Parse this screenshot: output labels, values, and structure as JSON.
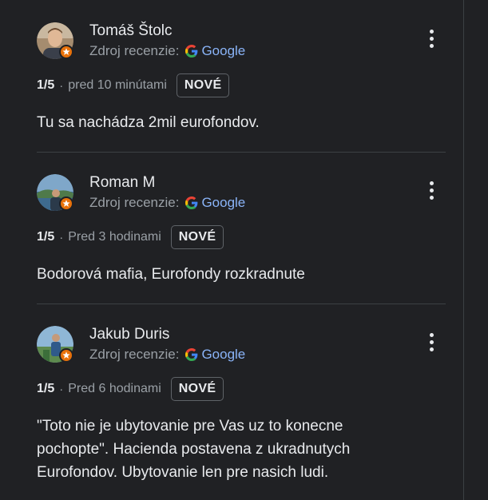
{
  "reviews": [
    {
      "name": "Tomáš Štolc",
      "source_label": "Zdroj recenzie:",
      "source_name": "Google",
      "rating": "1/5",
      "separator": "·",
      "time": "pred 10 minútami",
      "badge": "NOVÉ",
      "text": "Tu sa nachádza 2mil eurofondov."
    },
    {
      "name": "Roman M",
      "source_label": "Zdroj recenzie:",
      "source_name": "Google",
      "rating": "1/5",
      "separator": "·",
      "time": "Pred 3 hodinami",
      "badge": "NOVÉ",
      "text": "Bodorová mafia, Eurofondy rozkradnute"
    },
    {
      "name": "Jakub Duris",
      "source_label": "Zdroj recenzie:",
      "source_name": "Google",
      "rating": "1/5",
      "separator": "·",
      "time": "Pred 6 hodinami",
      "badge": "NOVÉ",
      "text": "\"Toto nie je ubytovanie pre Vas uz to konecne pochopte\". Hacienda postavena z ukradnutych Eurofondov. Ubytovanie len pre nasich ludi."
    }
  ],
  "icons": {
    "more": "more-vert-icon",
    "google": "google-g-icon",
    "local_guide": "local-guide-star-icon"
  },
  "colors": {
    "background": "#202124",
    "text": "#e8eaed",
    "secondary": "#9aa0a6",
    "link": "#8ab4f8",
    "guide_badge": "#e8710a"
  }
}
